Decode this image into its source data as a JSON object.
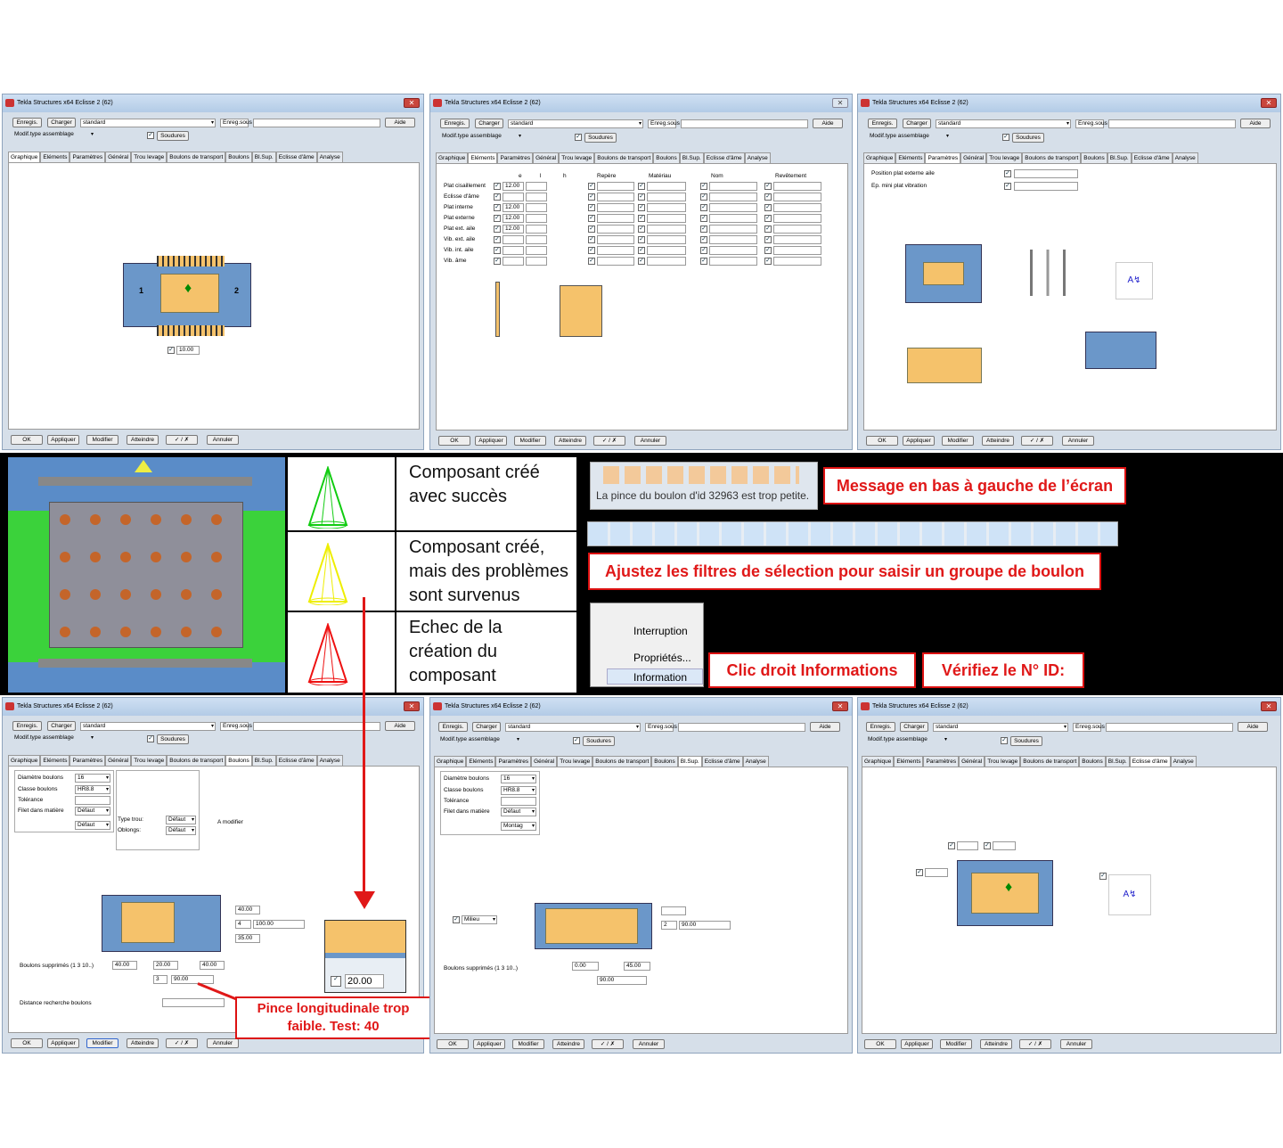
{
  "window": {
    "title": "Tekla Structures x64  Eclisse 2 (62)",
    "btn_save": "Enregis.",
    "btn_load": "Charger",
    "preset": "standard",
    "saveas": "Enreg.sous",
    "help": "Aide",
    "assembly_type": "Modif.type assemblage",
    "welds": "Soudures",
    "footer": {
      "ok": "OK",
      "apply": "Appliquer",
      "modify": "Modifier",
      "get": "Atteindre",
      "toggle": "✓ / ✗",
      "cancel": "Annuler"
    }
  },
  "tabs": [
    "Graphique",
    "Eléments",
    "Paramètres",
    "Général",
    "Trou levage",
    "Boulons de transport",
    "Boulons",
    "Bl.Sup.",
    "Eclisse d'âme",
    "Analyse"
  ],
  "w1": {
    "label_left": "1",
    "label_right": "2",
    "dim": "10.00"
  },
  "w2": {
    "headers": {
      "e": "e",
      "l": "l",
      "h": "h",
      "rep": "Repère",
      "mat": "Matériau",
      "nom": "Nom",
      "rev": "Revêtement"
    },
    "rows": [
      {
        "name": "Plat cisaillement",
        "e": "12.00"
      },
      {
        "name": "Eclisse d'âme",
        "e": ""
      },
      {
        "name": "Plat interne",
        "e": "12.00"
      },
      {
        "name": "Plat externe",
        "e": "12.00"
      },
      {
        "name": "Plat ext. aile",
        "e": "12.00"
      },
      {
        "name": "Vib. ext. aile",
        "e": ""
      },
      {
        "name": "Vib. int. aile",
        "e": ""
      },
      {
        "name": "Vib. âme",
        "e": ""
      }
    ]
  },
  "w3": {
    "p1": "Position plat externe aile",
    "p2": "Ep. mini plat vibration"
  },
  "legend": {
    "ok": "Composant créé avec succès",
    "warn": "Composant créé, mais des problèmes sont survenus",
    "fail": "Echec de la création du composant"
  },
  "status_msg": "La pince du boulon d'id 32963 est trop petite.",
  "context_menu": {
    "i1": "Interruption",
    "i2": "Propriétés...",
    "i3": "Information"
  },
  "callouts": {
    "c1": "Message en bas à gauche de l’écran",
    "c2": "Ajustez les filtres de sélection pour saisir un groupe de boulon",
    "c3": "Clic droit Informations",
    "c4": "Vérifiez le N° ID:",
    "c5": "Pince longitudinale trop faible.  Test: 40"
  },
  "w4": {
    "diam_l": "Diamètre boulons",
    "diam": "16",
    "class_l": "Classe boulons",
    "class": "HR8.8",
    "tol_l": "Tolérance",
    "filet_l": "Filet dans matière",
    "defaut": "Défaut",
    "trou_l": "Type trou:",
    "obl_l": "Oblongs:",
    "amod": "A modifier",
    "v1": "40.00",
    "v2": "4",
    "v3": "100.00",
    "v4": "35.00",
    "b1": "40.00",
    "b2": "20.00",
    "b3": "40.00",
    "b4": "3",
    "b5": "90.00",
    "supp": "Boulons supprimés (1 3 10..)",
    "dist": "Distance recherche boulons",
    "zoom": "20.00"
  },
  "w5": {
    "montag": "Montag",
    "milieu": "Milieu",
    "v2": "2",
    "v3": "90.00",
    "b1": "0.00",
    "b2": "45.00",
    "b5": "90.00"
  }
}
